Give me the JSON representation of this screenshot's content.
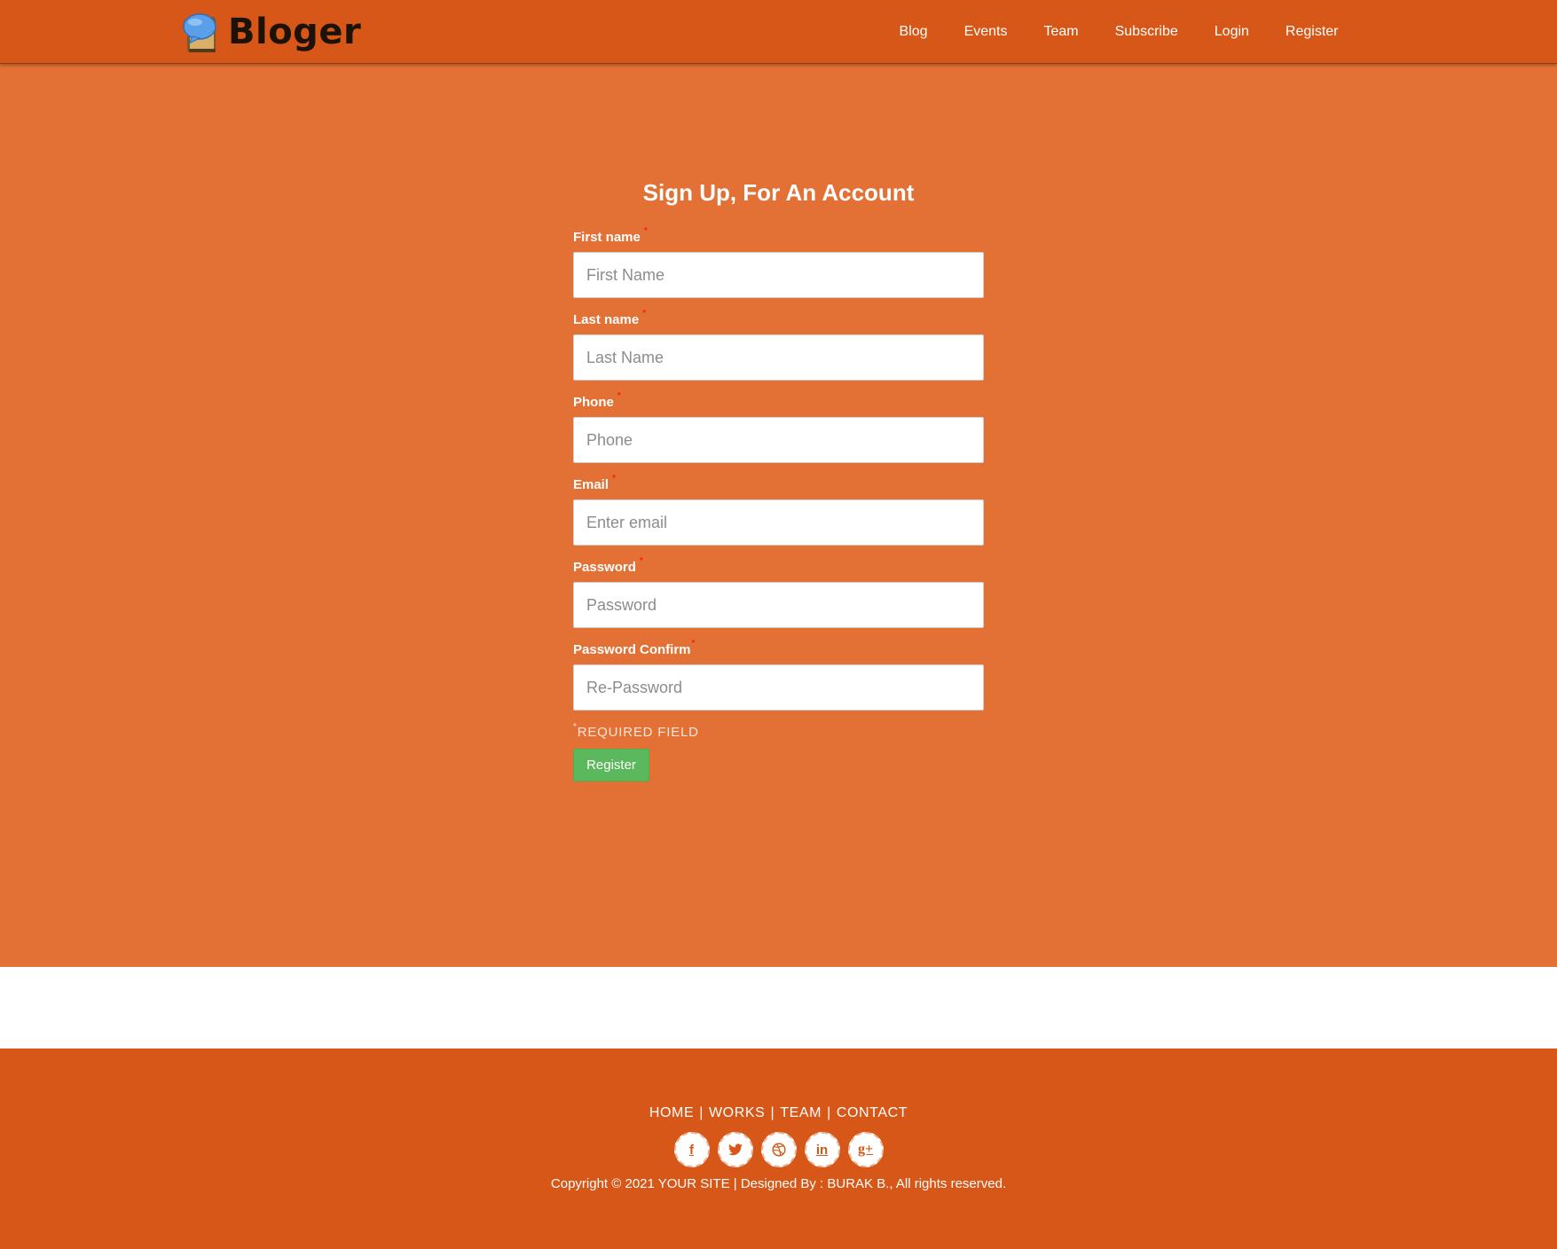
{
  "colors": {
    "navbar": "#d65717",
    "hero": "#e37135",
    "footer": "#d65717",
    "button": "#5cb85c",
    "required_star": "#ff1a1a"
  },
  "brand": {
    "name": "Bloger",
    "logo_icon": "speech-bubble-notebook-icon"
  },
  "nav": {
    "items": [
      {
        "label": "Blog"
      },
      {
        "label": "Events"
      },
      {
        "label": "Team"
      },
      {
        "label": "Subscribe"
      },
      {
        "label": "Login"
      },
      {
        "label": "Register"
      }
    ]
  },
  "form": {
    "title": "Sign Up, For An Account",
    "required_mark": "*",
    "fields": [
      {
        "label": "First name",
        "placeholder": "First Name",
        "value": ""
      },
      {
        "label": "Last name",
        "placeholder": "Last Name",
        "value": ""
      },
      {
        "label": "Phone",
        "placeholder": "Phone",
        "value": ""
      },
      {
        "label": "Email",
        "placeholder": "Enter email",
        "value": ""
      },
      {
        "label": "Password",
        "placeholder": "Password",
        "value": ""
      },
      {
        "label": "Password Confirm",
        "placeholder": "Re-Password",
        "value": ""
      }
    ],
    "required_note": "REQUIRED FIELD",
    "submit_label": "Register"
  },
  "footer": {
    "links": [
      {
        "label": "HOME"
      },
      {
        "label": "WORKS"
      },
      {
        "label": "TEAM"
      },
      {
        "label": "CONTACT"
      }
    ],
    "separator": "|",
    "socials": [
      {
        "icon": "facebook-icon",
        "glyph": "f"
      },
      {
        "icon": "twitter-icon",
        "glyph": ""
      },
      {
        "icon": "dribbble-icon",
        "glyph": ""
      },
      {
        "icon": "linkedin-icon",
        "glyph": "in"
      },
      {
        "icon": "google-plus-icon",
        "glyph": "g+"
      }
    ],
    "copyright": "Copyright © 2021 YOUR SITE | Designed By : BURAK B., All rights reserved."
  }
}
